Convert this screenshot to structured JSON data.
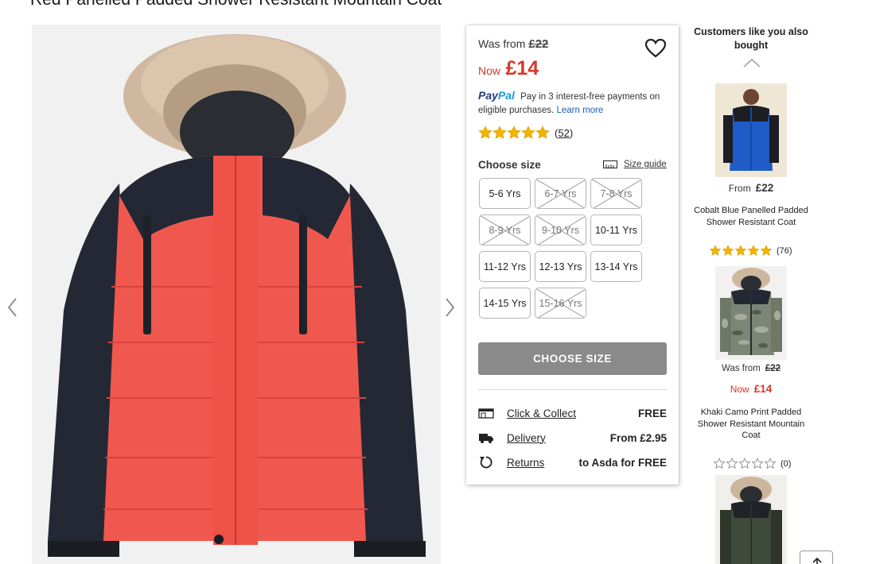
{
  "product": {
    "title": "Red Panelled Padded Shower Resistant Mountain Coat"
  },
  "colors": {
    "accent_red": "#d7372c",
    "coat_red": "#f0584f",
    "coat_navy": "#232733"
  },
  "pricing": {
    "was_label": "Was from",
    "was_price": "£22",
    "now_label": "Now",
    "now_price": "£14"
  },
  "paypal": {
    "logo_pay": "Pay",
    "logo_pal": "Pal",
    "text": "Pay in 3 interest-free payments on eligible purchases.",
    "learn_more": "Learn more"
  },
  "rating": {
    "stars": 5,
    "count_open": "(",
    "count": "52",
    "count_close": ")"
  },
  "size_selector": {
    "label": "Choose size",
    "size_guide": "Size guide",
    "sizes": [
      {
        "label": "5-6 Yrs",
        "available": true
      },
      {
        "label": "6-7 Yrs",
        "available": false
      },
      {
        "label": "7-8 Yrs",
        "available": false
      },
      {
        "label": "8-9 Yrs",
        "available": false
      },
      {
        "label": "9-10 Yrs",
        "available": false
      },
      {
        "label": "10-11 Yrs",
        "available": true
      },
      {
        "label": "11-12 Yrs",
        "available": true
      },
      {
        "label": "12-13 Yrs",
        "available": true
      },
      {
        "label": "13-14 Yrs",
        "available": true
      },
      {
        "label": "14-15 Yrs",
        "available": true
      },
      {
        "label": "15-16 Yrs",
        "available": false
      }
    ],
    "cta": "CHOOSE SIZE"
  },
  "services": [
    {
      "icon": "store-icon",
      "label": "Click & Collect",
      "value": "FREE"
    },
    {
      "icon": "truck-icon",
      "label": "Delivery",
      "value": "From £2.95"
    },
    {
      "icon": "returns-icon",
      "label": "Returns",
      "value": "to Asda for FREE"
    }
  ],
  "recommendations": {
    "heading": "Customers like you also bought",
    "items": [
      {
        "price_prefix": "From",
        "price": "£22",
        "name": "Cobalt Blue Panelled Padded Shower Resistant Coat",
        "rating_stars": 5,
        "rating_count": "(76)"
      },
      {
        "was_label": "Was from",
        "was_price": "£22",
        "now_label": "Now",
        "now_price": "£14",
        "name": "Khaki Camo Print Padded Shower Resistant Mountain Coat",
        "rating_stars": 0,
        "rating_count": "(0)"
      },
      {
        "name": ""
      }
    ]
  }
}
